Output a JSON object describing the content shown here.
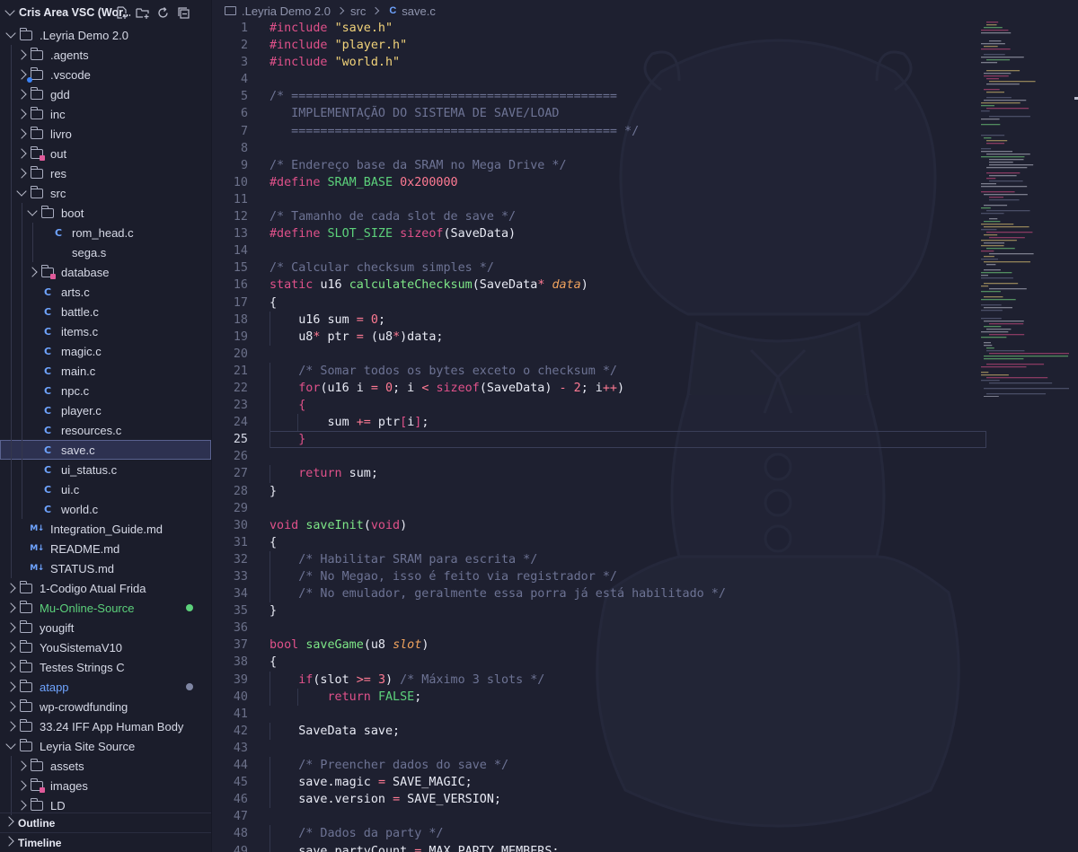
{
  "sidebar": {
    "title": "Cris Area VSC (Wor...",
    "actions": [
      "new-file-icon",
      "new-folder-icon",
      "refresh-icon",
      "collapse-all-icon"
    ],
    "tree": [
      {
        "label": ".Leyria Demo 2.0",
        "type": "folder",
        "depth": 0,
        "expanded": true
      },
      {
        "label": ".agents",
        "type": "folder",
        "depth": 1,
        "expanded": false
      },
      {
        "label": ".vscode",
        "type": "folder",
        "depth": 1,
        "expanded": false,
        "badge": "vscode"
      },
      {
        "label": "gdd",
        "type": "folder",
        "depth": 1,
        "expanded": false
      },
      {
        "label": "inc",
        "type": "folder",
        "depth": 1,
        "expanded": false
      },
      {
        "label": "livro",
        "type": "folder",
        "depth": 1,
        "expanded": false
      },
      {
        "label": "out",
        "type": "folder",
        "depth": 1,
        "expanded": false,
        "badge": "out"
      },
      {
        "label": "res",
        "type": "folder",
        "depth": 1,
        "expanded": false
      },
      {
        "label": "src",
        "type": "folder",
        "depth": 1,
        "expanded": true
      },
      {
        "label": "boot",
        "type": "folder",
        "depth": 2,
        "expanded": true
      },
      {
        "label": "rom_head.c",
        "type": "c",
        "depth": 3
      },
      {
        "label": "sega.s",
        "type": "s",
        "depth": 3
      },
      {
        "label": "database",
        "type": "folder",
        "depth": 2,
        "expanded": false,
        "badge": "db"
      },
      {
        "label": "arts.c",
        "type": "c",
        "depth": 2
      },
      {
        "label": "battle.c",
        "type": "c",
        "depth": 2
      },
      {
        "label": "items.c",
        "type": "c",
        "depth": 2
      },
      {
        "label": "magic.c",
        "type": "c",
        "depth": 2
      },
      {
        "label": "main.c",
        "type": "c",
        "depth": 2
      },
      {
        "label": "npc.c",
        "type": "c",
        "depth": 2
      },
      {
        "label": "player.c",
        "type": "c",
        "depth": 2
      },
      {
        "label": "resources.c",
        "type": "c",
        "depth": 2
      },
      {
        "label": "save.c",
        "type": "c",
        "depth": 2,
        "selected": true
      },
      {
        "label": "ui_status.c",
        "type": "c",
        "depth": 2
      },
      {
        "label": "ui.c",
        "type": "c",
        "depth": 2
      },
      {
        "label": "world.c",
        "type": "c",
        "depth": 2
      },
      {
        "label": "Integration_Guide.md",
        "type": "md",
        "depth": 1
      },
      {
        "label": "README.md",
        "type": "md",
        "depth": 1
      },
      {
        "label": "STATUS.md",
        "type": "md",
        "depth": 1
      },
      {
        "label": "1-Codigo Atual Frida",
        "type": "folder",
        "depth": 0,
        "expanded": false
      },
      {
        "label": "Mu-Online-Source",
        "type": "folder",
        "depth": 0,
        "expanded": false,
        "color": "green",
        "dot": "#5cd17b"
      },
      {
        "label": "yougift",
        "type": "folder",
        "depth": 0,
        "expanded": false
      },
      {
        "label": "YouSistemaV10",
        "type": "folder",
        "depth": 0,
        "expanded": false
      },
      {
        "label": "Testes Strings C",
        "type": "folder",
        "depth": 0,
        "expanded": false
      },
      {
        "label": "atapp",
        "type": "folder",
        "depth": 0,
        "expanded": false,
        "color": "blue",
        "dot": "#7f86a3"
      },
      {
        "label": "wp-crowdfunding",
        "type": "folder",
        "depth": 0,
        "expanded": false
      },
      {
        "label": "33.24 IFF App Human Body",
        "type": "folder",
        "depth": 0,
        "expanded": false
      },
      {
        "label": "Leyria Site Source",
        "type": "folder",
        "depth": 0,
        "expanded": true
      },
      {
        "label": "assets",
        "type": "folder",
        "depth": 1,
        "expanded": false
      },
      {
        "label": "images",
        "type": "folder",
        "depth": 1,
        "expanded": false,
        "badge": "img"
      },
      {
        "label": "LD",
        "type": "folder",
        "depth": 1,
        "expanded": false
      }
    ],
    "panels": [
      "Outline",
      "Timeline"
    ]
  },
  "breadcrumb": [
    ".Leyria Demo 2.0",
    "src",
    "save.c"
  ],
  "editor": {
    "active_line": 25,
    "lines": [
      [
        [
          "pp",
          "#include "
        ],
        [
          "str",
          "\"save.h\""
        ]
      ],
      [
        [
          "pp",
          "#include "
        ],
        [
          "str",
          "\"player.h\""
        ]
      ],
      [
        [
          "pp",
          "#include "
        ],
        [
          "str",
          "\"world.h\""
        ]
      ],
      [],
      [
        [
          "cm",
          "/* ============================================="
        ]
      ],
      [
        [
          "cm",
          "   IMPLEMENTAÇÃO DO SISTEMA DE SAVE/LOAD"
        ]
      ],
      [
        [
          "cm",
          "   ============================================= */"
        ]
      ],
      [],
      [
        [
          "cm",
          "/* Endereço base da SRAM no Mega Drive */"
        ]
      ],
      [
        [
          "pp",
          "#define "
        ],
        [
          "mac",
          "SRAM_BASE"
        ],
        [
          "plain",
          " "
        ],
        [
          "num",
          "0x200000"
        ]
      ],
      [],
      [
        [
          "cm",
          "/* Tamanho de cada slot de save */"
        ]
      ],
      [
        [
          "pp",
          "#define "
        ],
        [
          "mac",
          "SLOT_SIZE"
        ],
        [
          "plain",
          " "
        ],
        [
          "kw",
          "sizeof"
        ],
        [
          "plain",
          "(SaveData)"
        ]
      ],
      [],
      [
        [
          "cm",
          "/* Calcular checksum simples */"
        ]
      ],
      [
        [
          "kw",
          "static"
        ],
        [
          "plain",
          " "
        ],
        [
          "ty",
          "u16"
        ],
        [
          "plain",
          " "
        ],
        [
          "fn",
          "calculateChecksum"
        ],
        [
          "plain",
          "(SaveData"
        ],
        [
          "op",
          "*"
        ],
        [
          "plain",
          " "
        ],
        [
          "par",
          "data"
        ],
        [
          "plain",
          ")"
        ]
      ],
      [
        [
          "plain",
          "{"
        ]
      ],
      [
        [
          "plain",
          "    "
        ],
        [
          "ty",
          "u16"
        ],
        [
          "plain",
          " sum "
        ],
        [
          "op",
          "="
        ],
        [
          "plain",
          " "
        ],
        [
          "num",
          "0"
        ],
        [
          "plain",
          ";"
        ]
      ],
      [
        [
          "plain",
          "    "
        ],
        [
          "ty",
          "u8"
        ],
        [
          "op",
          "*"
        ],
        [
          "plain",
          " ptr "
        ],
        [
          "op",
          "="
        ],
        [
          "plain",
          " (u8"
        ],
        [
          "op",
          "*"
        ],
        [
          "plain",
          ")data;"
        ]
      ],
      [],
      [
        [
          "plain",
          "    "
        ],
        [
          "cm",
          "/* Somar todos os bytes exceto o checksum */"
        ]
      ],
      [
        [
          "plain",
          "    "
        ],
        [
          "kw",
          "for"
        ],
        [
          "plain",
          "(u16 i "
        ],
        [
          "op",
          "="
        ],
        [
          "plain",
          " "
        ],
        [
          "num",
          "0"
        ],
        [
          "plain",
          "; i "
        ],
        [
          "op",
          "<"
        ],
        [
          "plain",
          " "
        ],
        [
          "kw",
          "sizeof"
        ],
        [
          "plain",
          "(SaveData) "
        ],
        [
          "op",
          "-"
        ],
        [
          "plain",
          " "
        ],
        [
          "num",
          "2"
        ],
        [
          "plain",
          "; i"
        ],
        [
          "op",
          "++"
        ],
        [
          "plain",
          ")"
        ]
      ],
      [
        [
          "plain",
          "    "
        ],
        [
          "br",
          "{"
        ]
      ],
      [
        [
          "plain",
          "        sum "
        ],
        [
          "op",
          "+="
        ],
        [
          "plain",
          " ptr"
        ],
        [
          "br",
          "["
        ],
        [
          "plain",
          "i"
        ],
        [
          "br",
          "]"
        ],
        [
          "plain",
          ";"
        ]
      ],
      [
        [
          "plain",
          "    "
        ],
        [
          "br",
          "}"
        ]
      ],
      [],
      [
        [
          "plain",
          "    "
        ],
        [
          "kw",
          "return"
        ],
        [
          "plain",
          " sum;"
        ]
      ],
      [
        [
          "plain",
          "}"
        ]
      ],
      [],
      [
        [
          "kw",
          "void"
        ],
        [
          "plain",
          " "
        ],
        [
          "fn",
          "saveInit"
        ],
        [
          "plain",
          "("
        ],
        [
          "kw",
          "void"
        ],
        [
          "plain",
          ")"
        ]
      ],
      [
        [
          "plain",
          "{"
        ]
      ],
      [
        [
          "plain",
          "    "
        ],
        [
          "cm",
          "/* Habilitar SRAM para escrita */"
        ]
      ],
      [
        [
          "plain",
          "    "
        ],
        [
          "cm",
          "/* No Megao, isso é feito via registrador */"
        ]
      ],
      [
        [
          "plain",
          "    "
        ],
        [
          "cm",
          "/* No emulador, geralmente essa porra já está habilitado */"
        ]
      ],
      [
        [
          "plain",
          "}"
        ]
      ],
      [],
      [
        [
          "kw",
          "bool"
        ],
        [
          "plain",
          " "
        ],
        [
          "fn",
          "saveGame"
        ],
        [
          "plain",
          "(u8 "
        ],
        [
          "par",
          "slot"
        ],
        [
          "plain",
          ")"
        ]
      ],
      [
        [
          "plain",
          "{"
        ]
      ],
      [
        [
          "plain",
          "    "
        ],
        [
          "kw",
          "if"
        ],
        [
          "plain",
          "(slot "
        ],
        [
          "op",
          ">="
        ],
        [
          "plain",
          " "
        ],
        [
          "num",
          "3"
        ],
        [
          "plain",
          ") "
        ],
        [
          "cm",
          "/* Máximo 3 slots */"
        ]
      ],
      [
        [
          "plain",
          "        "
        ],
        [
          "kw",
          "return"
        ],
        [
          "plain",
          " "
        ],
        [
          "mac",
          "FALSE"
        ],
        [
          "plain",
          ";"
        ]
      ],
      [],
      [
        [
          "plain",
          "    SaveData save;"
        ]
      ],
      [],
      [
        [
          "plain",
          "    "
        ],
        [
          "cm",
          "/* Preencher dados do save */"
        ]
      ],
      [
        [
          "plain",
          "    save.magic "
        ],
        [
          "op",
          "="
        ],
        [
          "plain",
          " SAVE_MAGIC;"
        ]
      ],
      [
        [
          "plain",
          "    save.version "
        ],
        [
          "op",
          "="
        ],
        [
          "plain",
          " SAVE_VERSION;"
        ]
      ],
      [],
      [
        [
          "plain",
          "    "
        ],
        [
          "cm",
          "/* Dados da party */"
        ]
      ],
      [
        [
          "plain",
          "    save.partyCount "
        ],
        [
          "op",
          "="
        ],
        [
          "plain",
          " MAX_PARTY_MEMBERS;"
        ]
      ]
    ]
  },
  "colors": {
    "sidebar_bg": "#1b1d2b",
    "editor_bg": "#1e2030",
    "selection": "#2d3150",
    "keyword": "#e0518a",
    "string": "#f2d37a",
    "comment": "#6d7394",
    "function": "#7ee787",
    "file_icon": "#6fa4ff"
  }
}
